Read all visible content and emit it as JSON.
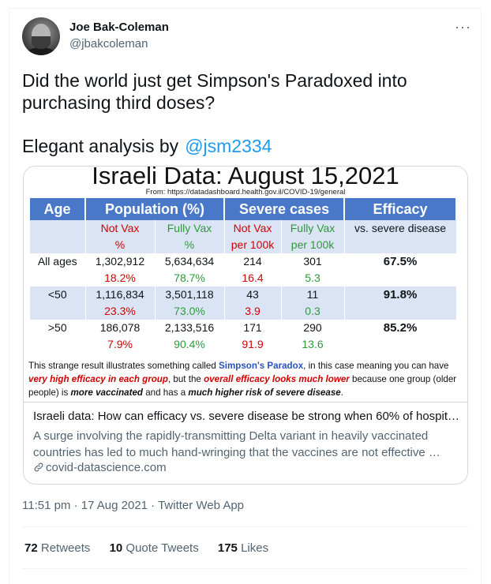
{
  "author": {
    "name": "Joe Bak-Coleman",
    "handle": "@jbakcoleman",
    "more": "···"
  },
  "tweet": {
    "line1": "Did the world just get Simpson's Paradoxed into purchasing third doses?",
    "line2": "Elegant analysis by",
    "mention": "@jsm2334"
  },
  "image": {
    "title": "Israeli Data: August 15,2021",
    "source": "From: https://datadashboard.health.gov.il/COVID-19/general",
    "headers": [
      "Age",
      "Population (%)",
      "Severe cases",
      "Efficacy"
    ],
    "subheaders": [
      "",
      "Not Vax\n%",
      "Fully Vax\n%",
      "Not Vax\nper 100k",
      "Fully Vax\nper 100k",
      "vs. severe disease"
    ],
    "rows": [
      {
        "age": "All ages",
        "nv_pop": "1,302,912",
        "nv_pct": "18.2%",
        "fv_pop": "5,634,634",
        "fv_pct": "78.7%",
        "nv_sev": "214",
        "nv_rate": "16.4",
        "fv_sev": "301",
        "fv_rate": "5.3",
        "eff": "67.5%"
      },
      {
        "age": "<50",
        "nv_pop": "1,116,834",
        "nv_pct": "23.3%",
        "fv_pop": "3,501,118",
        "fv_pct": "73.0%",
        "nv_sev": "43",
        "nv_rate": "3.9",
        "fv_sev": "11",
        "fv_rate": "0.3",
        "eff": "91.8%"
      },
      {
        "age": ">50",
        "nv_pop": "186,078",
        "nv_pct": "7.9%",
        "fv_pop": "2,133,516",
        "fv_pct": "90.4%",
        "nv_sev": "171",
        "nv_rate": "91.9",
        "fv_sev": "290",
        "fv_rate": "13.6",
        "eff": "85.2%"
      }
    ],
    "explain": {
      "p1": "This strange result illustrates something called ",
      "p2": "Simpson's Paradox",
      "p3": ", in this case meaning you can have ",
      "p4": "very high efficacy in each group",
      "p5": ", but the ",
      "p6": "overall efficacy looks much lower",
      "p7": " because one group (older people) is ",
      "p8": "more vaccinated",
      "p9": " and has a ",
      "p10": "much higher risk of severe disease",
      "p11": "."
    }
  },
  "card": {
    "title": "Israeli data: How can efficacy vs. severe disease be strong when 60% of hospit…",
    "desc": "A surge involving the rapidly-transmitting Delta variant in heavily vaccinated countries has led to much hand-wringing that the vaccines are not effective …",
    "domain": "covid-datascience.com"
  },
  "meta": {
    "timestamp": "11:51 pm · 17 Aug 2021 · Twitter Web App"
  },
  "stats": {
    "retweets": "72",
    "retweets_label": "Retweets",
    "quotes": "10",
    "quotes_label": "Quote Tweets",
    "likes": "175",
    "likes_label": "Likes"
  },
  "colors": {
    "accent": "#1d9bf0",
    "header_blue": "#4a78c8",
    "band": "#dbe4f4",
    "red": "#d40000",
    "green": "#2d9a3a"
  }
}
